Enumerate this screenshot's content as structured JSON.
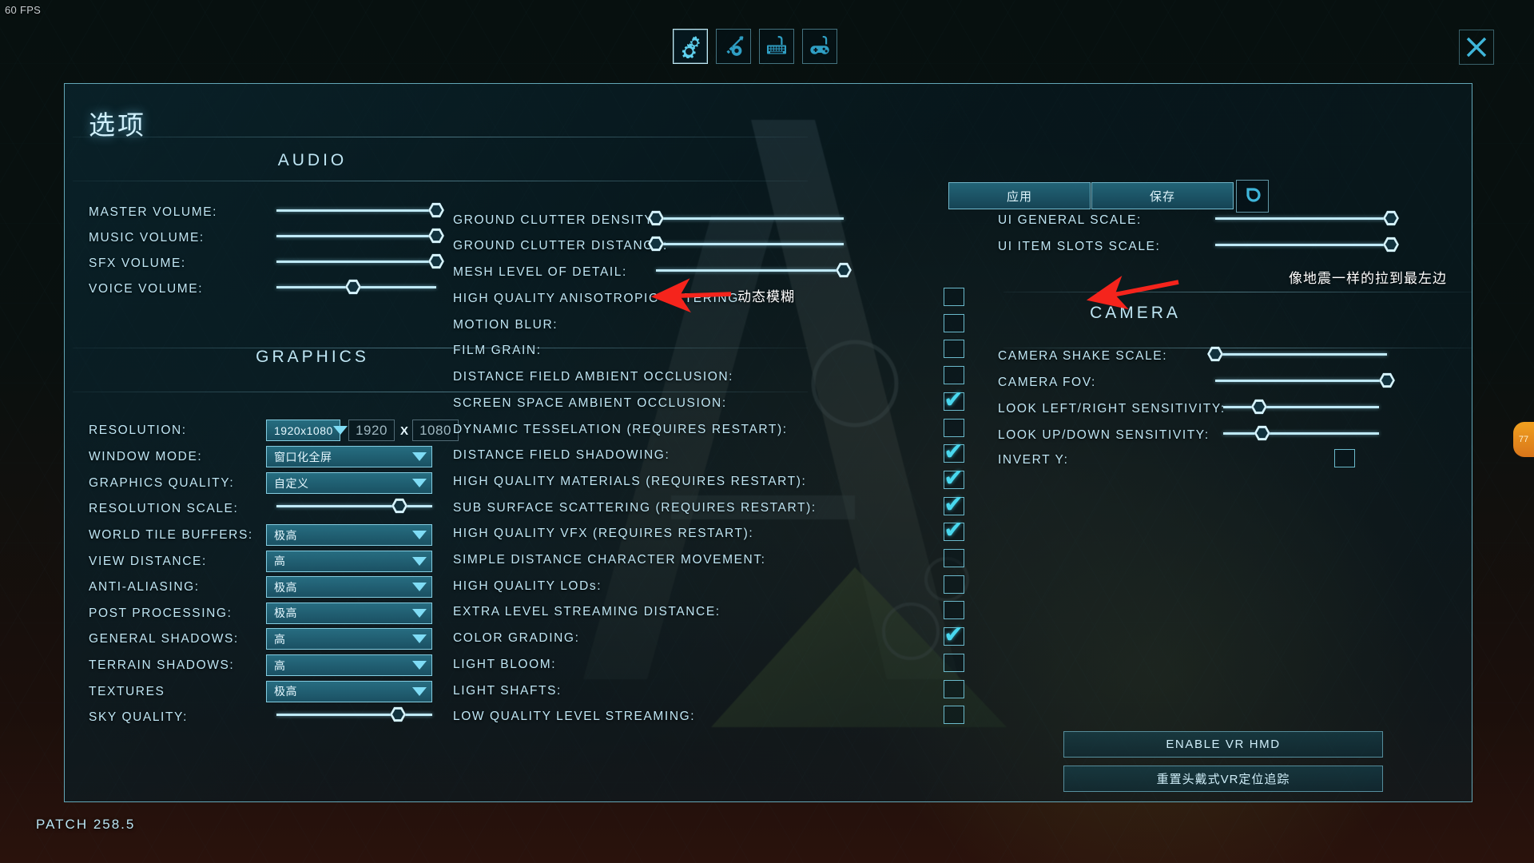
{
  "hud": {
    "fps": "60 FPS",
    "patch": "PATCH 258.5",
    "nub_label": "77"
  },
  "tabs": [
    {
      "name": "options-tab",
      "icon": "gears-icon",
      "active": true
    },
    {
      "name": "gameplay-tab",
      "icon": "sword-gear-icon",
      "active": false
    },
    {
      "name": "keyboard-tab",
      "icon": "keyboard-icon",
      "active": false
    },
    {
      "name": "gamepad-tab",
      "icon": "gamepad-icon",
      "active": false
    }
  ],
  "window": {
    "title": "选项",
    "close_icon": "close-icon",
    "apply_label": "应用",
    "save_label": "保存",
    "reset_icon": "reset-arrow-icon"
  },
  "sections": {
    "audio": "AUDIO",
    "graphics": "GRAPHICS",
    "camera": "CAMERA"
  },
  "audio": [
    {
      "label": "MASTER  VOLUME:",
      "value": 100
    },
    {
      "label": "MUSIC  VOLUME:",
      "value": 100
    },
    {
      "label": "SFX  VOLUME:",
      "value": 100
    },
    {
      "label": "VOICE  VOLUME:",
      "value": 48
    }
  ],
  "graphics": {
    "resolution": {
      "label": "RESOLUTION:",
      "selected": "1920x1080",
      "width_value": "1920",
      "separator": "X",
      "height_value": "1080"
    },
    "dropdowns": [
      {
        "label": "WINDOW  MODE:",
        "value": "窗口化全屏"
      },
      {
        "label": "GRAPHICS  QUALITY:",
        "value": "自定义"
      }
    ],
    "resolution_scale": {
      "label": "RESOLUTION  SCALE:",
      "value": 79
    },
    "quality_dropdowns": [
      {
        "label": "WORLD  TILE  BUFFERS:",
        "value": "极高"
      },
      {
        "label": "VIEW  DISTANCE:",
        "value": "高"
      },
      {
        "label": "ANTI-ALIASING:",
        "value": "极高"
      },
      {
        "label": "POST  PROCESSING:",
        "value": "极高"
      },
      {
        "label": "GENERAL  SHADOWS:",
        "value": "高"
      },
      {
        "label": "TERRAIN  SHADOWS:",
        "value": "高"
      },
      {
        "label": "TEXTURES",
        "value": "极高"
      }
    ],
    "sky_quality": {
      "label": "SKY  QUALITY:",
      "value": 78
    }
  },
  "middle": {
    "sliders": [
      {
        "label": "GROUND  CLUTTER  DENSITY:",
        "value": 0
      },
      {
        "label": "GROUND  CLUTTER  DISTANCE:",
        "value": 0
      },
      {
        "label": "MESH  LEVEL  OF  DETAIL:",
        "value": 100
      }
    ],
    "checkboxes": [
      {
        "label": "HIGH  QUALITY  ANISOTROPIC  FILTERING:",
        "checked": false
      },
      {
        "label": "MOTION  BLUR:",
        "checked": false
      },
      {
        "label": "FILM  GRAIN:",
        "checked": false
      },
      {
        "label": "DISTANCE  FIELD  AMBIENT  OCCLUSION:",
        "checked": false
      },
      {
        "label": "SCREEN  SPACE  AMBIENT  OCCLUSION:",
        "checked": true
      },
      {
        "label": "DYNAMIC  TESSELATION  (REQUIRES  RESTART):",
        "checked": false
      },
      {
        "label": "DISTANCE  FIELD  SHADOWING:",
        "checked": true
      },
      {
        "label": "HIGH  QUALITY  MATERIALS  (REQUIRES  RESTART):",
        "checked": true
      },
      {
        "label": "SUB  SURFACE  SCATTERING  (REQUIRES  RESTART):",
        "checked": true
      },
      {
        "label": "HIGH  QUALITY  VFX  (REQUIRES  RESTART):",
        "checked": true
      },
      {
        "label": "SIMPLE  DISTANCE  CHARACTER  MOVEMENT:",
        "checked": false
      },
      {
        "label": "HIGH  QUALITY  LODs:",
        "checked": false
      },
      {
        "label": "EXTRA  LEVEL  STREAMING  DISTANCE:",
        "checked": false
      },
      {
        "label": "COLOR  GRADING:",
        "checked": true
      },
      {
        "label": "LIGHT  BLOOM:",
        "checked": false
      },
      {
        "label": "LIGHT  SHAFTS:",
        "checked": false
      },
      {
        "label": "LOW  QUALITY  LEVEL  STREAMING:",
        "checked": false
      }
    ]
  },
  "right": {
    "ui_sliders": [
      {
        "label": "UI  GENERAL  SCALE:",
        "value": 100
      },
      {
        "label": "UI  ITEM  SLOTS  SCALE:",
        "value": 100
      }
    ],
    "camera_sliders": [
      {
        "label": "CAMERA  SHAKE  SCALE:",
        "value": 0
      },
      {
        "label": "CAMERA  FOV:",
        "value": 100
      },
      {
        "label": "LOOK  LEFT/RIGHT  SENSITIVITY:",
        "value": 23
      },
      {
        "label": "LOOK  UP/DOWN  SENSITIVITY:",
        "value": 25
      }
    ],
    "invert_y": {
      "label": "INVERT  Y:",
      "checked": false
    },
    "vr_buttons": [
      {
        "label": "ENABLE  VR  HMD"
      },
      {
        "label": "重置头戴式VR定位追踪"
      }
    ]
  },
  "annotations": [
    {
      "text": "动态模糊",
      "target": "motion-blur-row"
    },
    {
      "text": "像地震一样的拉到最左边",
      "target": "camera-shake-scale-row"
    }
  ]
}
